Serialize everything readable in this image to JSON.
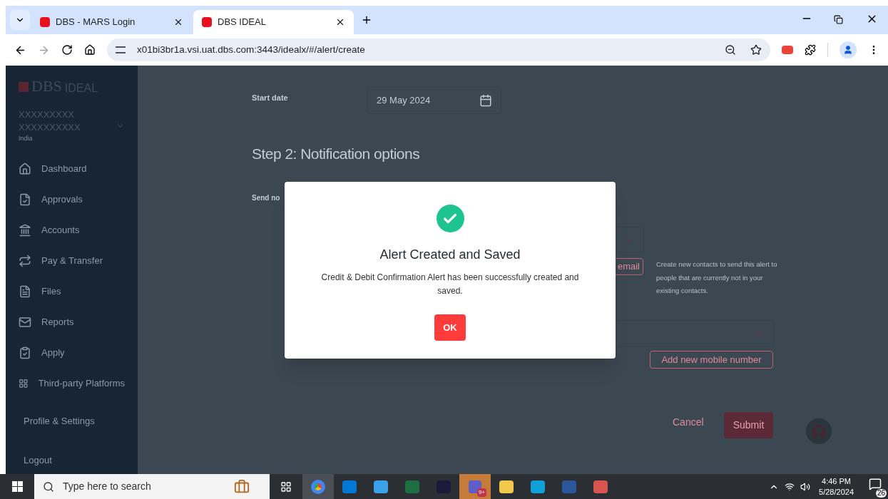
{
  "browser": {
    "tabs": [
      {
        "title": "DBS - MARS Login",
        "selected": false
      },
      {
        "title": "DBS IDEAL",
        "selected": true
      }
    ],
    "url": "x01bi3br1a.vsi.uat.dbs.com:3443/idealx/#/alert/create"
  },
  "sidebar": {
    "brand": "DBS",
    "product": "IDEAL",
    "company_lines": [
      "XXXXXXXXX",
      "XXXXXXXXXX"
    ],
    "country": "India",
    "nav": [
      "Dashboard",
      "Approvals",
      "Accounts",
      "Pay & Transfer",
      "Files",
      "Reports",
      "Apply",
      "Third-party Platforms"
    ],
    "links": [
      "Profile & Settings",
      "Logout"
    ]
  },
  "form": {
    "start_date_label": "Start date",
    "start_date_value": "29 May 2024",
    "step_title": "Step 2: Notification options",
    "send_label": "Send no",
    "email_button": "email",
    "help_text": "Create new contacts to send this alert to people that are currently not in your existing contacts.",
    "add_mobile_button": "Add new mobile number",
    "cancel": "Cancel",
    "submit": "Submit"
  },
  "modal": {
    "title": "Alert Created and Saved",
    "message": "Credit & Debit Confirmation Alert has been successfully created and saved.",
    "ok": "OK"
  },
  "taskbar": {
    "search_placeholder": "Type here to search",
    "teams_badge": "9+",
    "time": "4:46 PM",
    "date": "5/28/2024",
    "notifications": "26"
  }
}
